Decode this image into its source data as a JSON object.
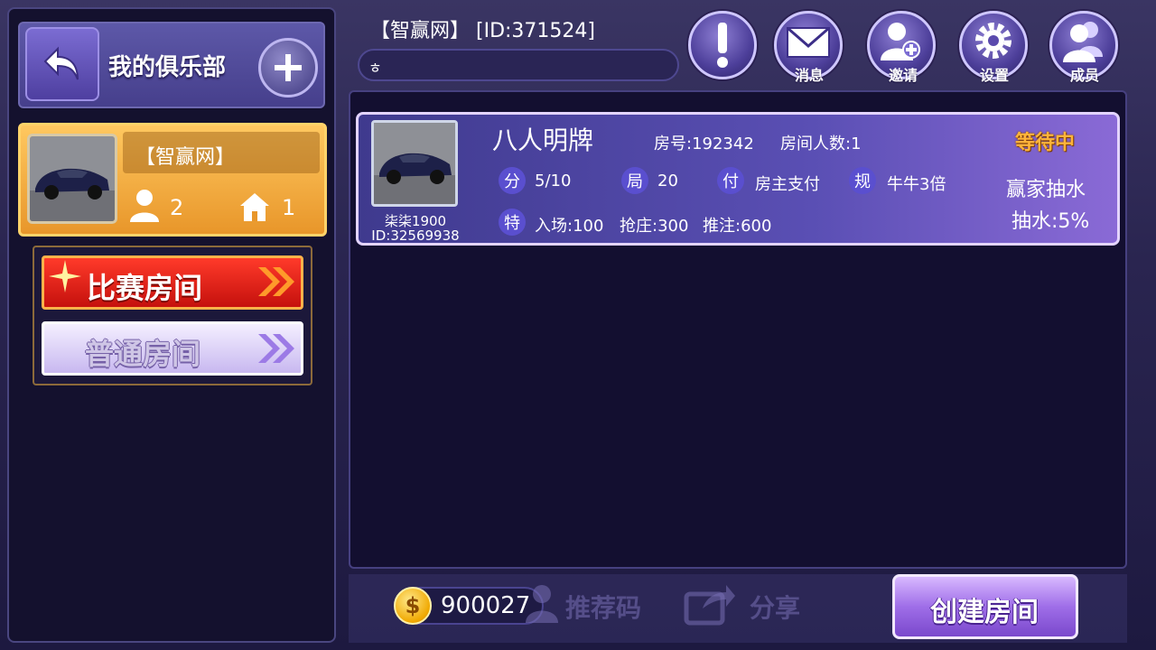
{
  "club_panel": {
    "title": "我的俱乐部",
    "club_name": "【智赢网】",
    "member_count": "2",
    "room_count": "1",
    "match_room_label": "比赛房间",
    "normal_room_label": "普通房间"
  },
  "header": {
    "title": "【智赢网】 [ID:371524]",
    "notice": "ㅎ",
    "buttons": {
      "messages": "消息",
      "invite": "邀请",
      "settings": "设置",
      "members": "成员"
    }
  },
  "room": {
    "owner_name": "柒柒1900",
    "owner_id": "ID:32569938",
    "title": "八人明牌",
    "room_no": "房号:192342",
    "player_count": "房间人数:1",
    "status": "等待中",
    "score_tag": "分",
    "score": "5/10",
    "rounds_tag": "局",
    "rounds": "20",
    "pay_tag": "付",
    "pay": "房主支付",
    "rule_tag": "规",
    "rule": "牛牛3倍",
    "special_tag": "特",
    "entry": "入场:100",
    "banker": "抢庄:300",
    "push": "推注:600",
    "rake_title": "赢家抽水",
    "rake_rate": "抽水:5%"
  },
  "bottom": {
    "coin_symbol": "$",
    "coins": "900027",
    "referral_label": "推荐码",
    "share_label": "分享",
    "create_room_label": "创建房间"
  },
  "colors": {
    "status": "#ffb43a",
    "card_border": "#e3d4ff",
    "match_red": "#e0201a",
    "gold": "#ffc860"
  }
}
